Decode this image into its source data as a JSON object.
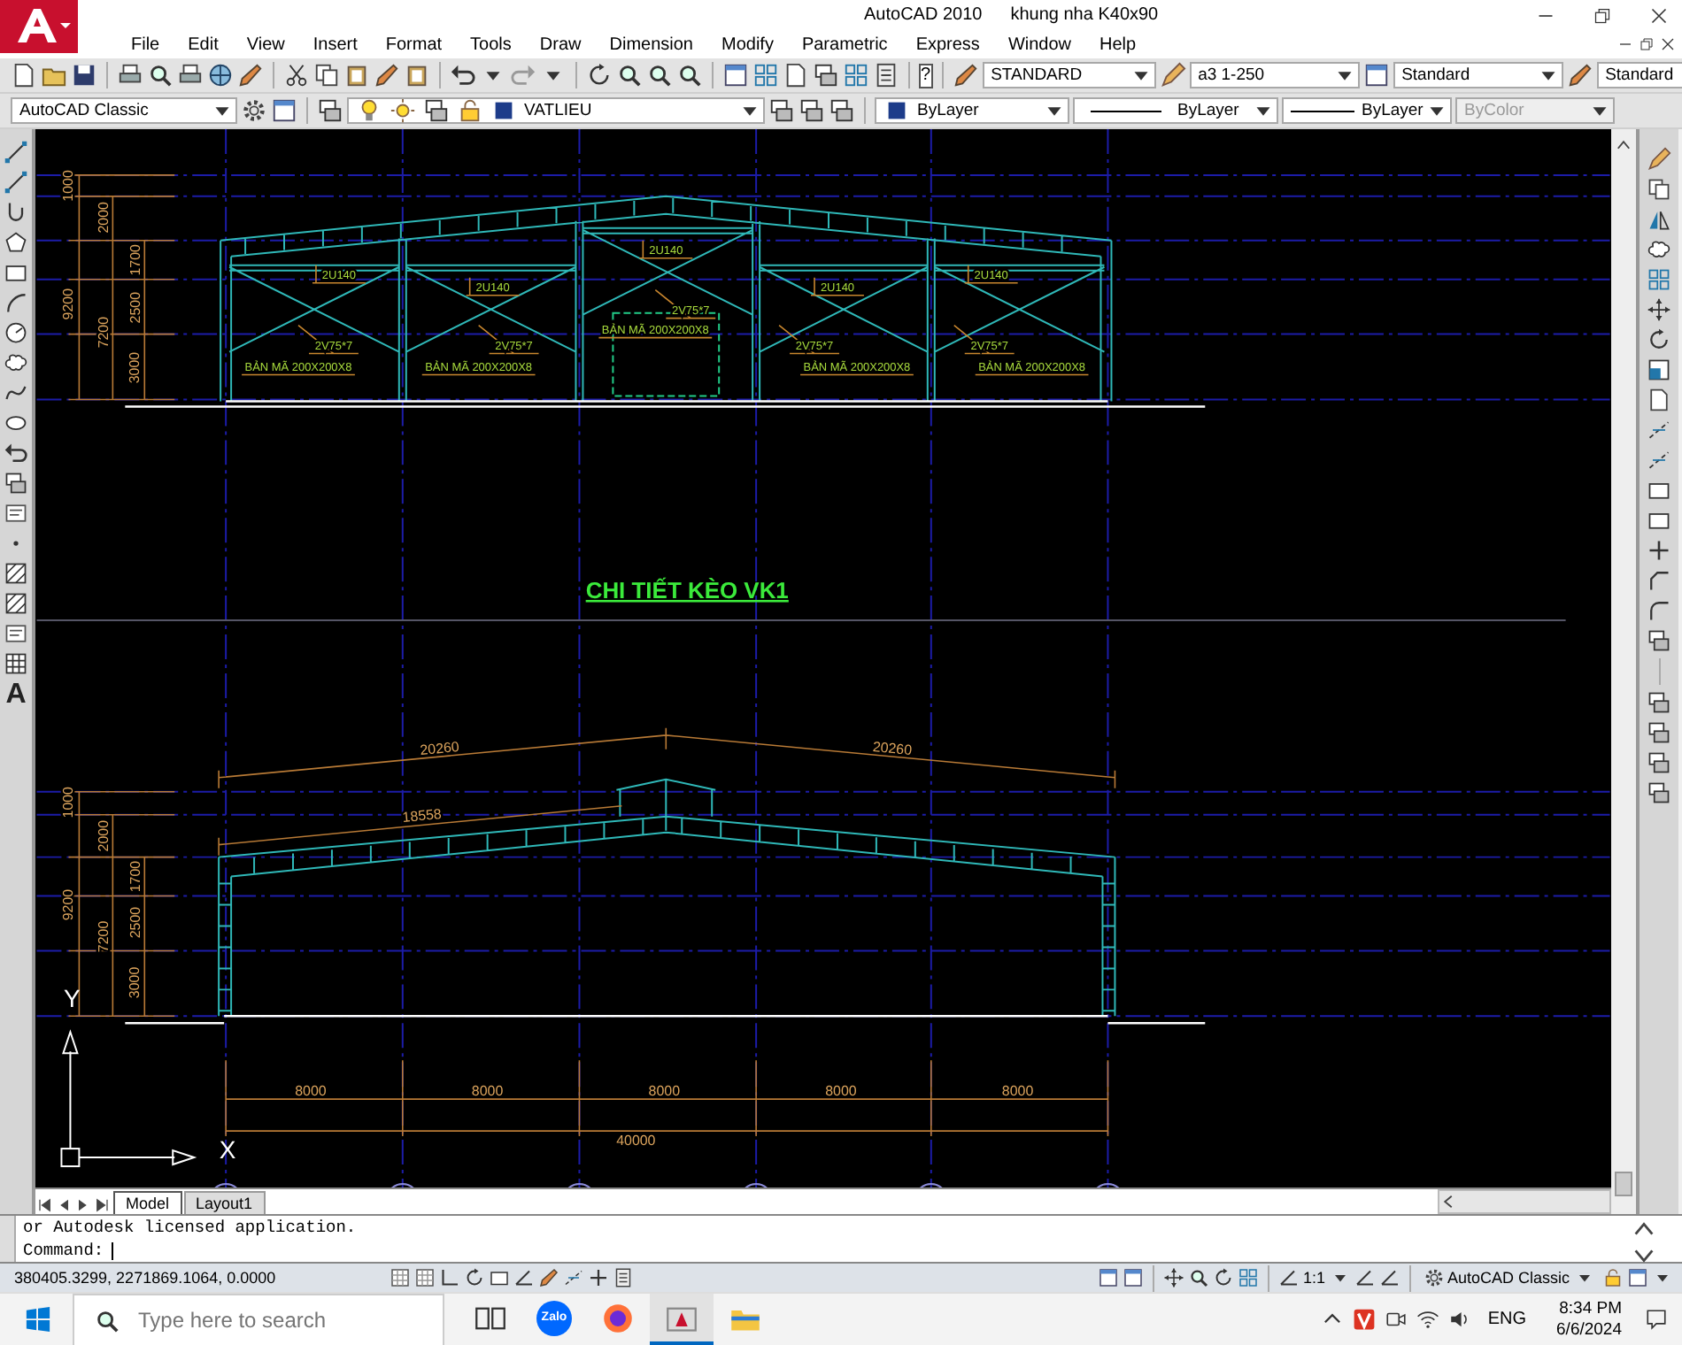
{
  "window": {
    "title": "AutoCAD 2010",
    "document": "khung nha K40x90"
  },
  "menu": [
    "File",
    "Edit",
    "View",
    "Insert",
    "Format",
    "Tools",
    "Draw",
    "Dimension",
    "Modify",
    "Parametric",
    "Express",
    "Window",
    "Help"
  ],
  "toolbars": {
    "help_glyph": "?",
    "text_style": "STANDARD",
    "dim_style": "a3 1-250",
    "table_style": "Standard",
    "multileader_style": "Standard",
    "workspace": "AutoCAD Classic",
    "layer": "VATLIEU",
    "color_setting": "ByLayer",
    "linetype": "ByLayer",
    "lineweight": "ByLayer",
    "plot_style": {
      "value": "ByColor",
      "disabled": true
    }
  },
  "draw_toolbar": {
    "text_tool_glyph": "A"
  },
  "drawing": {
    "upper_frame": {
      "height_dims": [
        "1000",
        "2000",
        "9200",
        "7200",
        "1700",
        "2500",
        "3000"
      ],
      "beam_labels": [
        "2U140",
        "2U140",
        "2U140",
        "2U140",
        "2U140"
      ],
      "brace_labels": [
        "2V75*7",
        "2V75*7",
        "2V75*7",
        "2V75*7",
        "2V75*7"
      ],
      "plate_labels": [
        "BẢN MÃ 200X200X8",
        "BẢN MÃ 200X200X8",
        "BẢN MÃ 200X200X8",
        "BẢN MÃ 200X200X8",
        "BẢN MÃ 200X200X8"
      ]
    },
    "section_title": "CHI TIẾT KÈO VK1",
    "lower_frame": {
      "height_dims": [
        "1000",
        "2000",
        "9200",
        "7200",
        "1700",
        "2500",
        "3000"
      ],
      "rafter_dims": [
        "20260",
        "20260",
        "18558"
      ],
      "bay_dims": [
        "8000",
        "8000",
        "8000",
        "8000",
        "8000"
      ],
      "overall_dim": "40000"
    },
    "ucs": {
      "y_label": "Y",
      "x_label": "X"
    }
  },
  "layout_tabs": [
    {
      "label": "Model",
      "selected": true
    },
    {
      "label": "Layout1",
      "selected": false
    }
  ],
  "command": {
    "history": "or Autodesk licensed application.",
    "prompt": "Command:"
  },
  "status_bar": {
    "coordinates": "380405.3299, 2271869.1064, 0.0000",
    "annotation_scale": "1:1",
    "workspace": "AutoCAD Classic"
  },
  "taskbar": {
    "search_placeholder": "Type here to search",
    "apps": [
      {
        "kind": "task_view",
        "selected": false
      },
      {
        "kind": "zalo",
        "label": "Zalo",
        "selected": false
      },
      {
        "kind": "firefox",
        "selected": false
      },
      {
        "kind": "autocad",
        "selected": true
      },
      {
        "kind": "explorer",
        "selected": false
      }
    ],
    "language": "ENG",
    "time": "8:34 PM",
    "date": "6/6/2024"
  }
}
